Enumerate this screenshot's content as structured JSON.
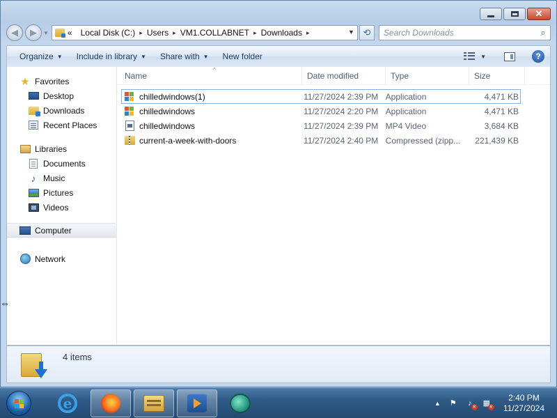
{
  "window": {
    "controls": {
      "minimize": "minimize",
      "maximize": "maximize",
      "close": "✕"
    }
  },
  "address": {
    "history_glyph": "«",
    "breadcrumbs": [
      "Local Disk (C:)",
      "Users",
      "VM1.COLLABNET",
      "Downloads"
    ]
  },
  "search": {
    "placeholder": "Search Downloads"
  },
  "toolbar": {
    "organize": "Organize",
    "include_in_library": "Include in library",
    "share_with": "Share with",
    "new_folder": "New folder"
  },
  "nav": {
    "favorites": "Favorites",
    "favorites_items": [
      "Desktop",
      "Downloads",
      "Recent Places"
    ],
    "libraries": "Libraries",
    "libraries_items": [
      "Documents",
      "Music",
      "Pictures",
      "Videos"
    ],
    "computer": "Computer",
    "network": "Network"
  },
  "columns": {
    "name": "Name",
    "date": "Date modified",
    "type": "Type",
    "size": "Size"
  },
  "files": [
    {
      "name": "chilledwindows(1)",
      "date": "11/27/2024 2:39 PM",
      "type": "Application",
      "size": "4,471 KB",
      "icon": "application-icon"
    },
    {
      "name": "chilledwindows",
      "date": "11/27/2024 2:20 PM",
      "type": "Application",
      "size": "4,471 KB",
      "icon": "application-icon"
    },
    {
      "name": "chilledwindows",
      "date": "11/27/2024 2:39 PM",
      "type": "MP4 Video",
      "size": "3,684 KB",
      "icon": "video-file-icon"
    },
    {
      "name": "current-a-week-with-doors",
      "date": "11/27/2024 2:40 PM",
      "type": "Compressed (zipp...",
      "size": "221,439 KB",
      "icon": "zip-folder-icon"
    }
  ],
  "status": {
    "item_count": "4 items"
  },
  "taskbar": {
    "clock_time": "2:40 PM",
    "clock_date": "11/27/2024"
  }
}
